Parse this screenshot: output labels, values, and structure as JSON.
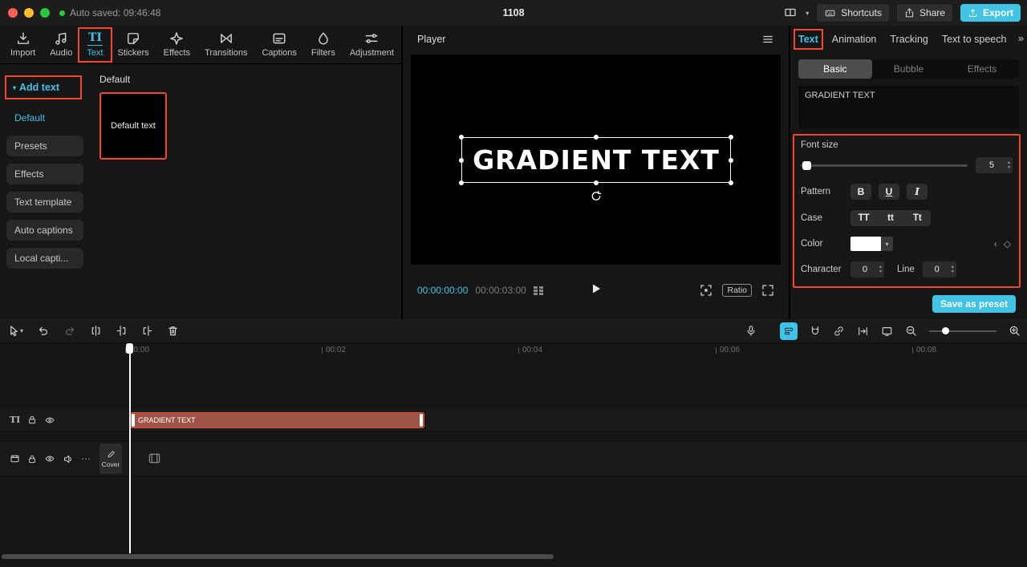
{
  "colors": {
    "accent": "#41c3e6",
    "annotation": "#f2472a",
    "clip_fill": "#9d5345",
    "clip_border": "#ef4e2d"
  },
  "titlebar": {
    "autosave": "Auto saved: 09:46:48",
    "doc_title": "1108",
    "shortcuts": "Shortcuts",
    "share": "Share",
    "export": "Export"
  },
  "tools": {
    "items": [
      {
        "label": "Import"
      },
      {
        "label": "Audio"
      },
      {
        "label": "Text"
      },
      {
        "label": "Stickers"
      },
      {
        "label": "Effects"
      },
      {
        "label": "Transitions"
      },
      {
        "label": "Captions"
      },
      {
        "label": "Filters"
      },
      {
        "label": "Adjustment"
      }
    ]
  },
  "sidebar": {
    "add_text": "Add text",
    "items": [
      {
        "label": "Default"
      },
      {
        "label": "Presets"
      },
      {
        "label": "Effects"
      },
      {
        "label": "Text template"
      },
      {
        "label": "Auto captions"
      },
      {
        "label": "Local capti..."
      }
    ]
  },
  "library": {
    "section": "Default",
    "card": "Default text"
  },
  "player": {
    "title": "Player",
    "preview_text": "GRADIENT TEXT",
    "current": "00:00:00:00",
    "duration": "00:00:03:00",
    "ratio": "Ratio"
  },
  "inspector": {
    "tabs": [
      {
        "label": "Text"
      },
      {
        "label": "Animation"
      },
      {
        "label": "Tracking"
      },
      {
        "label": "Text to speech"
      }
    ],
    "subtabs": [
      {
        "label": "Basic"
      },
      {
        "label": "Bubble"
      },
      {
        "label": "Effects"
      }
    ],
    "text_value": "GRADIENT TEXT",
    "font_size": {
      "label": "Font size",
      "value": "5"
    },
    "pattern": {
      "label": "Pattern",
      "bold": "B",
      "underline": "U",
      "italic": "I"
    },
    "case": {
      "label": "Case",
      "upper": "TT",
      "lower": "tt",
      "title": "Tt"
    },
    "color": {
      "label": "Color"
    },
    "character": {
      "label": "Character",
      "value": "0"
    },
    "line": {
      "label": "Line",
      "value": "0"
    },
    "save_preset": "Save as preset"
  },
  "timeline": {
    "ruler": [
      {
        "t": "00:00"
      },
      {
        "t": "00:02"
      },
      {
        "t": "00:04"
      },
      {
        "t": "00:06"
      },
      {
        "t": "00:08"
      }
    ],
    "clip": "GRADIENT TEXT",
    "cover": "Cover"
  }
}
